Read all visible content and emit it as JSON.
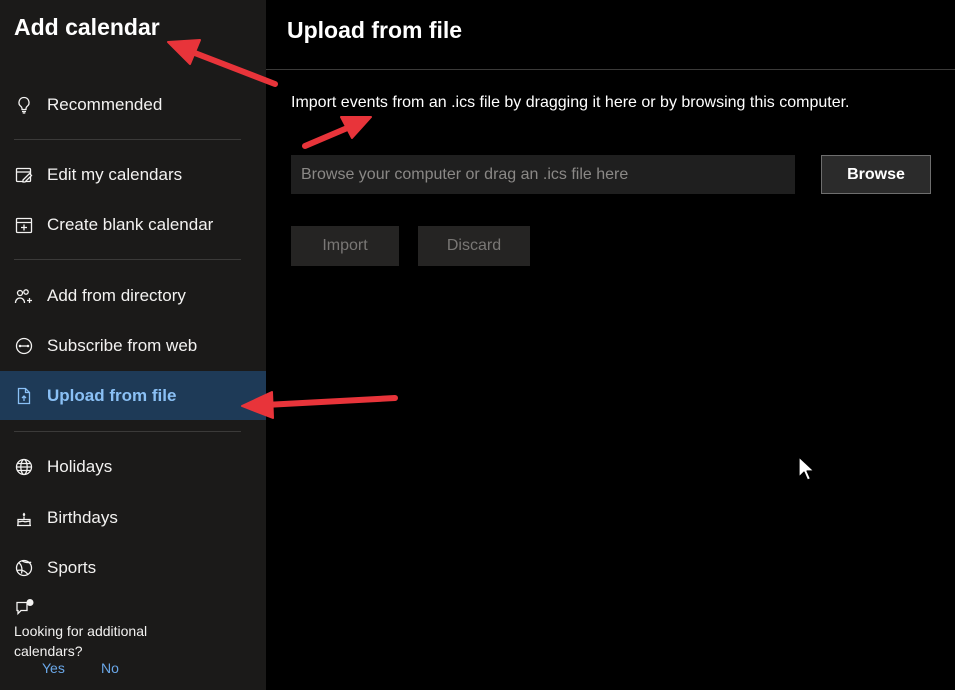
{
  "sidebar": {
    "title": "Add calendar",
    "items": [
      {
        "label": "Recommended",
        "icon": "lightbulb-icon"
      },
      {
        "label": "Edit my calendars",
        "icon": "edit-calendar-icon"
      },
      {
        "label": "Create blank calendar",
        "icon": "add-calendar-icon"
      },
      {
        "label": "Add from directory",
        "icon": "people-add-icon"
      },
      {
        "label": "Subscribe from web",
        "icon": "link-circle-icon"
      },
      {
        "label": "Upload from file",
        "icon": "file-upload-icon",
        "active": true
      },
      {
        "label": "Holidays",
        "icon": "globe-icon"
      },
      {
        "label": "Birthdays",
        "icon": "cake-icon"
      },
      {
        "label": "Sports",
        "icon": "sports-ball-icon"
      }
    ],
    "feedback": {
      "text": "Looking for additional calendars?",
      "yes": "Yes",
      "no": "No"
    }
  },
  "main": {
    "title": "Upload from file",
    "instructions": "Import events from an .ics file by dragging it here or by browsing this computer.",
    "file_input_placeholder": "Browse your computer or drag an .ics file here",
    "browse_label": "Browse",
    "import_label": "Import",
    "discard_label": "Discard"
  },
  "colors": {
    "sidebar_bg": "#1b1a19",
    "active_bg": "#1e3a57",
    "active_text": "#8ac0f5",
    "link": "#6aa7e8",
    "annotation_arrow": "#e8343a"
  }
}
